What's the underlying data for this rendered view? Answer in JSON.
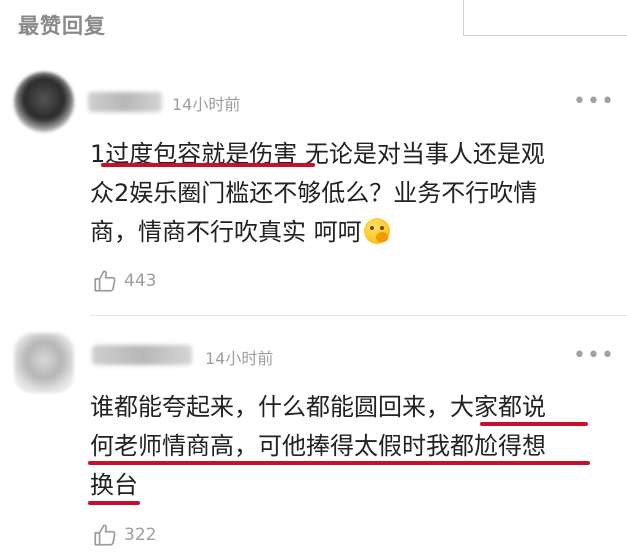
{
  "section": {
    "title": "最赞回复"
  },
  "comments": [
    {
      "time": "14小时前",
      "more": "•••",
      "lines": [
        {
          "parts": [
            "1",
            "过度包容就是伤害",
            " 无论是对当事人还是观"
          ]
        },
        {
          "parts": [
            "众2娱乐圈门槛还不够低么？业务不行吹情"
          ]
        },
        {
          "parts": [
            "商，情商不行吹真实 呵呵"
          ]
        }
      ],
      "likes": "443"
    },
    {
      "time": "14小时前",
      "more": "•••",
      "lines": [
        {
          "parts": [
            "谁都能夸起来，什么都能圆回来，",
            "大家都说"
          ]
        },
        {
          "parts": [
            "何老师情商高，可他捧得太假时我都尬得想"
          ]
        },
        {
          "parts": [
            "换台"
          ]
        }
      ],
      "likes": "322"
    }
  ],
  "colors": {
    "underline": "#c8102e",
    "meta": "#9e9e9e",
    "text": "#222222"
  },
  "icons": {
    "like": "thumbs-up-icon",
    "more": "more-dots-icon",
    "emoji": "face-with-hand-over-mouth-emoji"
  }
}
